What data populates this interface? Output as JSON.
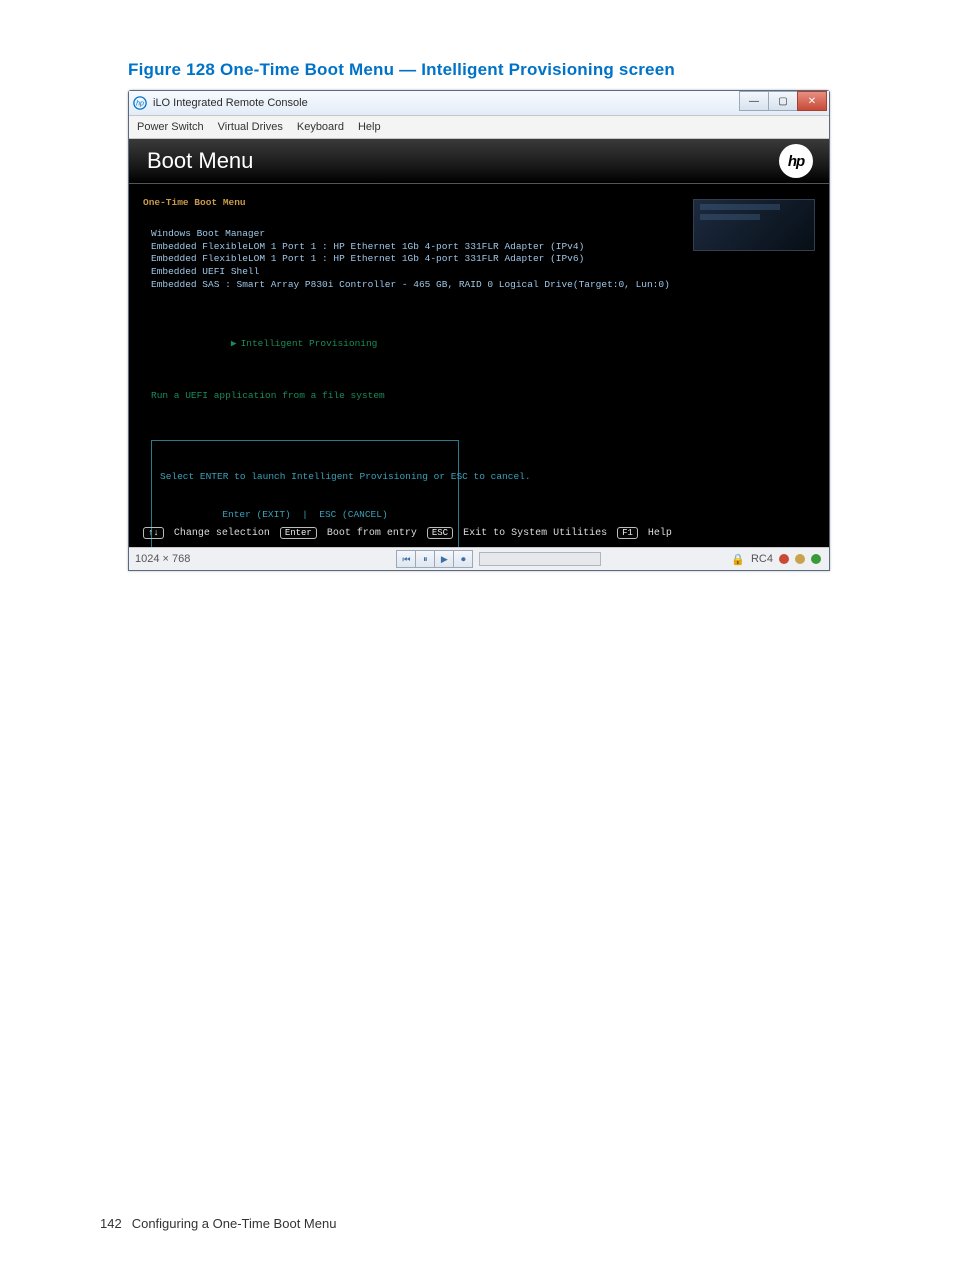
{
  "caption": "Figure 128 One-Time Boot Menu — Intelligent Provisioning screen",
  "window": {
    "title": "iLO Integrated Remote Console",
    "controls": {
      "min": "—",
      "max": "▢",
      "close": "✕"
    },
    "menu": [
      "Power Switch",
      "Virtual Drives",
      "Keyboard",
      "Help"
    ]
  },
  "console": {
    "header_title": "Boot Menu",
    "logo_text": "hp",
    "section_title": "One-Time Boot Menu",
    "items": [
      "Windows Boot Manager",
      "Embedded FlexibleLOM 1 Port 1 : HP Ethernet 1Gb 4-port 331FLR Adapter (IPv4)",
      "Embedded FlexibleLOM 1 Port 1 : HP Ethernet 1Gb 4-port 331FLR Adapter (IPv6)",
      "Embedded UEFI Shell",
      "Embedded SAS : Smart Array P830i Controller - 465 GB, RAID 0 Logical Drive(Target:0, Lun:0)"
    ],
    "selected": "Intelligent Provisioning",
    "after_selected": "Run a UEFI application from a file system",
    "prompt_line1": "Select ENTER to launch Intelligent Provisioning or ESC to cancel.",
    "prompt_line2": "Enter (EXIT)  |  ESC (CANCEL)",
    "keys": {
      "k1": "↑↓",
      "l1": "Change selection",
      "k2": "Enter",
      "l2": "Boot from entry",
      "k3": "ESC",
      "l3": "Exit to System Utilities",
      "k4": "F1",
      "l4": "Help"
    }
  },
  "status": {
    "resolution": "1024 × 768",
    "center_icons": [
      "⏮",
      "⏸",
      "▶",
      "⏺"
    ],
    "rc": "RC4"
  },
  "footer": {
    "page": "142",
    "text": "Configuring a One-Time Boot Menu"
  }
}
